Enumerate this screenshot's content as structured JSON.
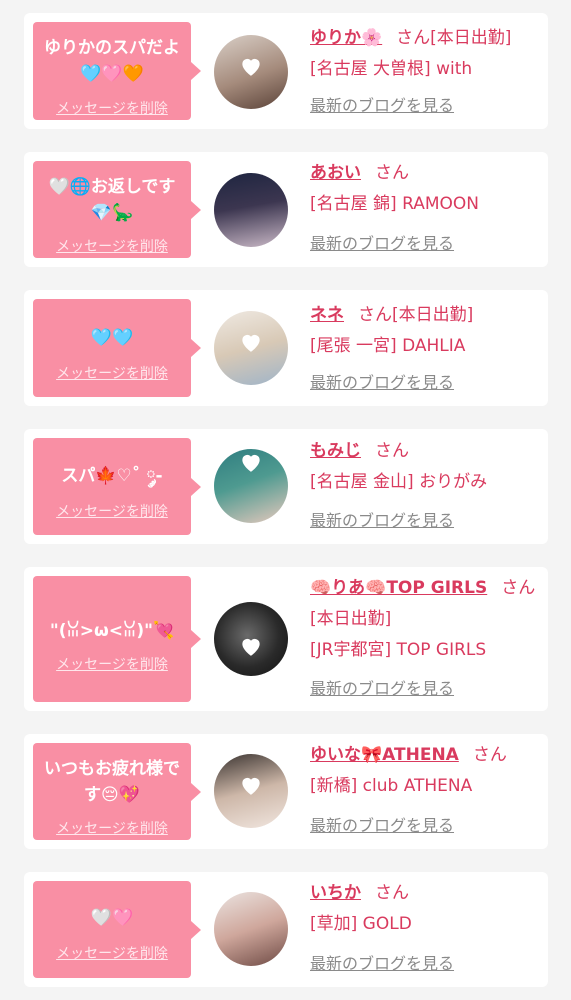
{
  "delete_label": "メッセージを削除",
  "san_label": "さん",
  "blog_label": "最新のブログを見る",
  "colors": {
    "bubble": "#f98fa4",
    "accent": "#d93a5e",
    "muted": "#8a8a8a",
    "card": "#ffffff",
    "background": "#f4f4f4"
  },
  "cards": [
    {
      "message": "ゆりかのスパだよ🩵🩷🧡",
      "name": "ゆりか🌸",
      "status": "[本日出勤]",
      "shop": "[名古屋 大曽根] with"
    },
    {
      "message": "🤍🌐お返しです💎🦕",
      "name": "あおい",
      "status": "",
      "shop": "[名古屋 錦] RAMOON"
    },
    {
      "message": "🩵🩵",
      "name": "ネネ",
      "status": "[本日出勤]",
      "shop": "[尾張 一宮] DAHLIA"
    },
    {
      "message": "スパ🍁♡˚ ༘-",
      "name": "もみじ",
      "status": "",
      "shop": "[名古屋 金山] おりがみ"
    },
    {
      "message": "\"(ꈍ>ω<ꈍ)\"💘",
      "name": "🧠りあ🧠TOP GIRLS",
      "status": "[本日出勤]",
      "shop": "[JR宇都宮] TOP GIRLS"
    },
    {
      "message": "いつもお疲れ様です😔💖",
      "name": "ゆいな🎀ATHENA",
      "status": "",
      "shop": "[新橋] club ATHENA"
    },
    {
      "message": "🤍🩷",
      "name": "いちか",
      "status": "",
      "shop": "[草加] GOLD"
    }
  ]
}
